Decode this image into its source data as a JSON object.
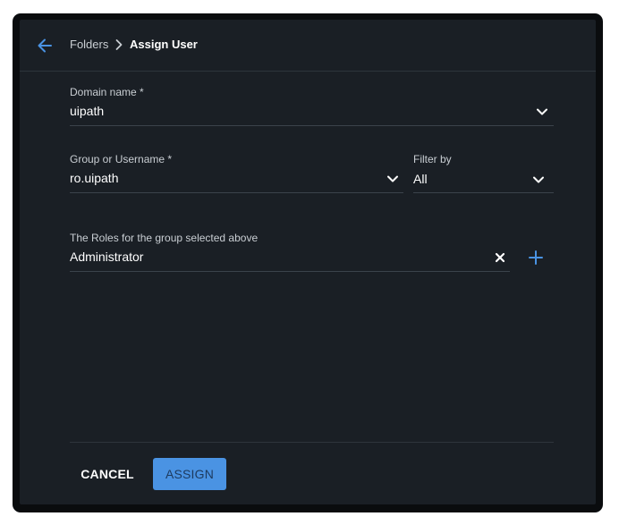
{
  "breadcrumb": {
    "parent": "Folders",
    "current": "Assign User"
  },
  "domain_field": {
    "label": "Domain name *",
    "value": "uipath"
  },
  "group_field": {
    "label": "Group or Username *",
    "value": "ro.uipath"
  },
  "filter_field": {
    "label": "Filter by",
    "value": "All"
  },
  "roles_field": {
    "label": "The Roles for the group selected above",
    "value": "Administrator"
  },
  "actions": {
    "cancel_label": "CANCEL",
    "assign_label": "ASSIGN"
  },
  "icons": {
    "back": "arrow-left-icon",
    "breadcrumb_separator": "chevron-right-icon",
    "dropdown": "chevron-down-icon",
    "clear": "close-icon",
    "add": "plus-icon"
  },
  "colors": {
    "dialog_background": "#1a1f25",
    "accent": "#4a93e3",
    "text_primary": "#ffffff",
    "text_secondary": "#c9ced3"
  }
}
